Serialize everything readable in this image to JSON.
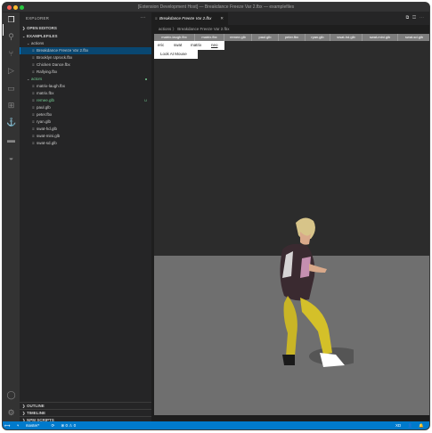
{
  "window": {
    "title": "[Extension Development Host] — Breakdance Freeze Var 2.fbx — examplefiles"
  },
  "activity_icons": [
    "files-icon",
    "search-icon",
    "source-control-icon",
    "run-debug-icon",
    "remote-explorer-icon",
    "extensions-icon",
    "anchor-icon",
    "folder-icon",
    "docker-icon",
    "account-icon",
    "settings-gear-icon"
  ],
  "sidebar": {
    "title": "EXPLORER",
    "more": "···",
    "open_editors": "OPEN EDITORS",
    "workspace": "EXAMPLEFILES",
    "folders": [
      {
        "name": "actions",
        "files": [
          {
            "name": "Breakdance Freeze Var 2.fbx",
            "selected": true
          },
          {
            "name": "Brooklyn Uprock.fbx"
          },
          {
            "name": "Chicken Dance.fbx"
          },
          {
            "name": "Rallying.fbx"
          }
        ]
      },
      {
        "name": "actors",
        "files": [
          {
            "name": "matrix-laugh.fbx"
          },
          {
            "name": "matrix.fbx"
          },
          {
            "name": "remee.glb",
            "badge": "U"
          },
          {
            "name": "paul.glb"
          },
          {
            "name": "peter.fbx"
          },
          {
            "name": "ryan.glb"
          },
          {
            "name": "swat-hd.glb"
          },
          {
            "name": "swat-mini.glb"
          },
          {
            "name": "swat-sd.glb"
          }
        ]
      }
    ],
    "bottom_sections": [
      "OUTLINE",
      "TIMELINE",
      "NPM SCRIPTS"
    ]
  },
  "editor": {
    "tab_label": "Breakdance Freeze Var 2.fbx",
    "tab_close": "✕",
    "breadcrumb": "actions  〉  Breakdance Freeze Var 2.fbx",
    "animations": [
      "matrix-laugh.fbx",
      "matrix.fbx",
      "remee.glb",
      "paul.glb",
      "peter.fbx",
      "ryan.glb",
      "swat-hd.glb",
      "swat-mini.glb",
      "swat-sd.glb"
    ],
    "characters": [
      "eric",
      "swat",
      "matrix",
      "neo"
    ],
    "selected_character": "neo",
    "look_at_mouse": "Look At Mouse"
  },
  "statusbar": {
    "branch": "master*",
    "sync": "⟳",
    "problems": "⊗ 0  ⚠ 0",
    "right_items": [
      "XD",
      "👤",
      "🔔"
    ]
  }
}
